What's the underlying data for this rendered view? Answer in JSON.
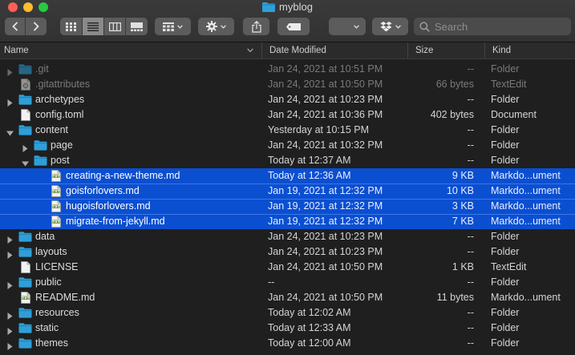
{
  "window": {
    "title": "myblog"
  },
  "colors": {
    "selection": "#0b4fd1",
    "folder": "#2f9fd8",
    "folder_dark": "#1f7fb6"
  },
  "toolbar": {
    "back_icon": "chevron-left-icon",
    "forward_icon": "chevron-right-icon",
    "view_modes": [
      "icon-view-icon",
      "list-view-icon",
      "column-view-icon",
      "gallery-view-icon"
    ],
    "group_icon": "group-grid-icon",
    "action_icon": "gear-icon",
    "share_icon": "share-icon",
    "tag_icon": "tag-icon",
    "dropbox_icon": "dropbox-icon"
  },
  "search": {
    "placeholder": "Search"
  },
  "columns": {
    "name": "Name",
    "date": "Date Modified",
    "size": "Size",
    "kind": "Kind"
  },
  "files": [
    {
      "name": ".git",
      "date": "Jan 24, 2021 at 10:51 PM",
      "size": "--",
      "kind": "Folder",
      "type": "folder",
      "depth": 0,
      "disclosure": "collapsed",
      "dim": true,
      "selected": false
    },
    {
      "name": ".gitattributes",
      "date": "Jan 24, 2021 at 10:50 PM",
      "size": "66 bytes",
      "kind": "TextEdit",
      "type": "gear-doc",
      "depth": 0,
      "disclosure": "none",
      "dim": true,
      "selected": false
    },
    {
      "name": "archetypes",
      "date": "Jan 24, 2021 at 10:23 PM",
      "size": "--",
      "kind": "Folder",
      "type": "folder",
      "depth": 0,
      "disclosure": "collapsed",
      "dim": false,
      "selected": false
    },
    {
      "name": "config.toml",
      "date": "Jan 24, 2021 at 10:36 PM",
      "size": "402 bytes",
      "kind": "Document",
      "type": "doc",
      "depth": 0,
      "disclosure": "none",
      "dim": false,
      "selected": false
    },
    {
      "name": "content",
      "date": "Yesterday at 10:15 PM",
      "size": "--",
      "kind": "Folder",
      "type": "folder",
      "depth": 0,
      "disclosure": "expanded",
      "dim": false,
      "selected": false
    },
    {
      "name": "page",
      "date": "Jan 24, 2021 at 10:32 PM",
      "size": "--",
      "kind": "Folder",
      "type": "folder",
      "depth": 1,
      "disclosure": "collapsed",
      "dim": false,
      "selected": false
    },
    {
      "name": "post",
      "date": "Today at 12:37 AM",
      "size": "--",
      "kind": "Folder",
      "type": "folder",
      "depth": 1,
      "disclosure": "expanded",
      "dim": false,
      "selected": false
    },
    {
      "name": "creating-a-new-theme.md",
      "date": "Today at 12:36 AM",
      "size": "9 KB",
      "kind": "Markdo...ument",
      "type": "txt",
      "depth": 2,
      "disclosure": "none",
      "dim": false,
      "selected": true
    },
    {
      "name": "goisforlovers.md",
      "date": "Jan 19, 2021 at 12:32 PM",
      "size": "10 KB",
      "kind": "Markdo...ument",
      "type": "txt",
      "depth": 2,
      "disclosure": "none",
      "dim": false,
      "selected": true
    },
    {
      "name": "hugoisforlovers.md",
      "date": "Jan 19, 2021 at 12:32 PM",
      "size": "3 KB",
      "kind": "Markdo...ument",
      "type": "txt",
      "depth": 2,
      "disclosure": "none",
      "dim": false,
      "selected": true
    },
    {
      "name": "migrate-from-jekyll.md",
      "date": "Jan 19, 2021 at 12:32 PM",
      "size": "7 KB",
      "kind": "Markdo...ument",
      "type": "txt",
      "depth": 2,
      "disclosure": "none",
      "dim": false,
      "selected": true
    },
    {
      "name": "data",
      "date": "Jan 24, 2021 at 10:23 PM",
      "size": "--",
      "kind": "Folder",
      "type": "folder",
      "depth": 0,
      "disclosure": "collapsed",
      "dim": false,
      "selected": false
    },
    {
      "name": "layouts",
      "date": "Jan 24, 2021 at 10:23 PM",
      "size": "--",
      "kind": "Folder",
      "type": "folder",
      "depth": 0,
      "disclosure": "collapsed",
      "dim": false,
      "selected": false
    },
    {
      "name": "LICENSE",
      "date": "Jan 24, 2021 at 10:50 PM",
      "size": "1 KB",
      "kind": "TextEdit",
      "type": "doc",
      "depth": 0,
      "disclosure": "none",
      "dim": false,
      "selected": false
    },
    {
      "name": "public",
      "date": "--",
      "size": "--",
      "kind": "Folder",
      "type": "folder",
      "depth": 0,
      "disclosure": "collapsed",
      "dim": false,
      "selected": false
    },
    {
      "name": "README.md",
      "date": "Jan 24, 2021 at 10:50 PM",
      "size": "11 bytes",
      "kind": "Markdo...ument",
      "type": "txt",
      "depth": 0,
      "disclosure": "none",
      "dim": false,
      "selected": false
    },
    {
      "name": "resources",
      "date": "Today at 12:02 AM",
      "size": "--",
      "kind": "Folder",
      "type": "folder",
      "depth": 0,
      "disclosure": "collapsed",
      "dim": false,
      "selected": false
    },
    {
      "name": "static",
      "date": "Today at 12:33 AM",
      "size": "--",
      "kind": "Folder",
      "type": "folder",
      "depth": 0,
      "disclosure": "collapsed",
      "dim": false,
      "selected": false
    },
    {
      "name": "themes",
      "date": "Today at 12:00 AM",
      "size": "--",
      "kind": "Folder",
      "type": "folder",
      "depth": 0,
      "disclosure": "collapsed",
      "dim": false,
      "selected": false
    }
  ]
}
